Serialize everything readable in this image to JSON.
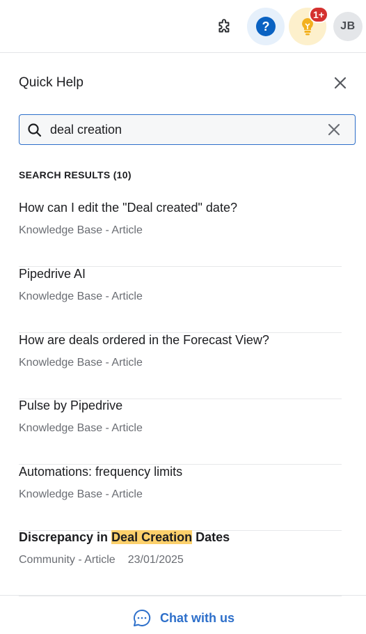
{
  "topbar": {
    "help_symbol": "?",
    "notification_count": "1+",
    "avatar_initials": "JB",
    "colors": {
      "help_accent": "#0a62c2",
      "bulb_accent": "#f2b01e",
      "badge": "#d4312f"
    }
  },
  "panel": {
    "title": "Quick Help"
  },
  "search": {
    "value": "deal creation"
  },
  "results": {
    "heading": "SEARCH RESULTS (10)",
    "items": [
      {
        "title": "How can I edit the \"Deal created\" date?",
        "meta": "Knowledge Base - Article"
      },
      {
        "title": "Pipedrive AI",
        "meta": "Knowledge Base - Article"
      },
      {
        "title": "How are deals ordered in the Forecast View?",
        "meta": "Knowledge Base - Article"
      },
      {
        "title": "Pulse by Pipedrive",
        "meta": "Knowledge Base - Article"
      },
      {
        "title": "Automations: frequency limits",
        "meta": "Knowledge Base - Article"
      },
      {
        "title_before": "Discrepancy in ",
        "title_highlight": "Deal Creation",
        "title_after": " Dates",
        "meta": "Community - Article",
        "date": "23/01/2025"
      }
    ]
  },
  "footer": {
    "chat_label": "Chat with us",
    "accent": "#2d6fca"
  }
}
